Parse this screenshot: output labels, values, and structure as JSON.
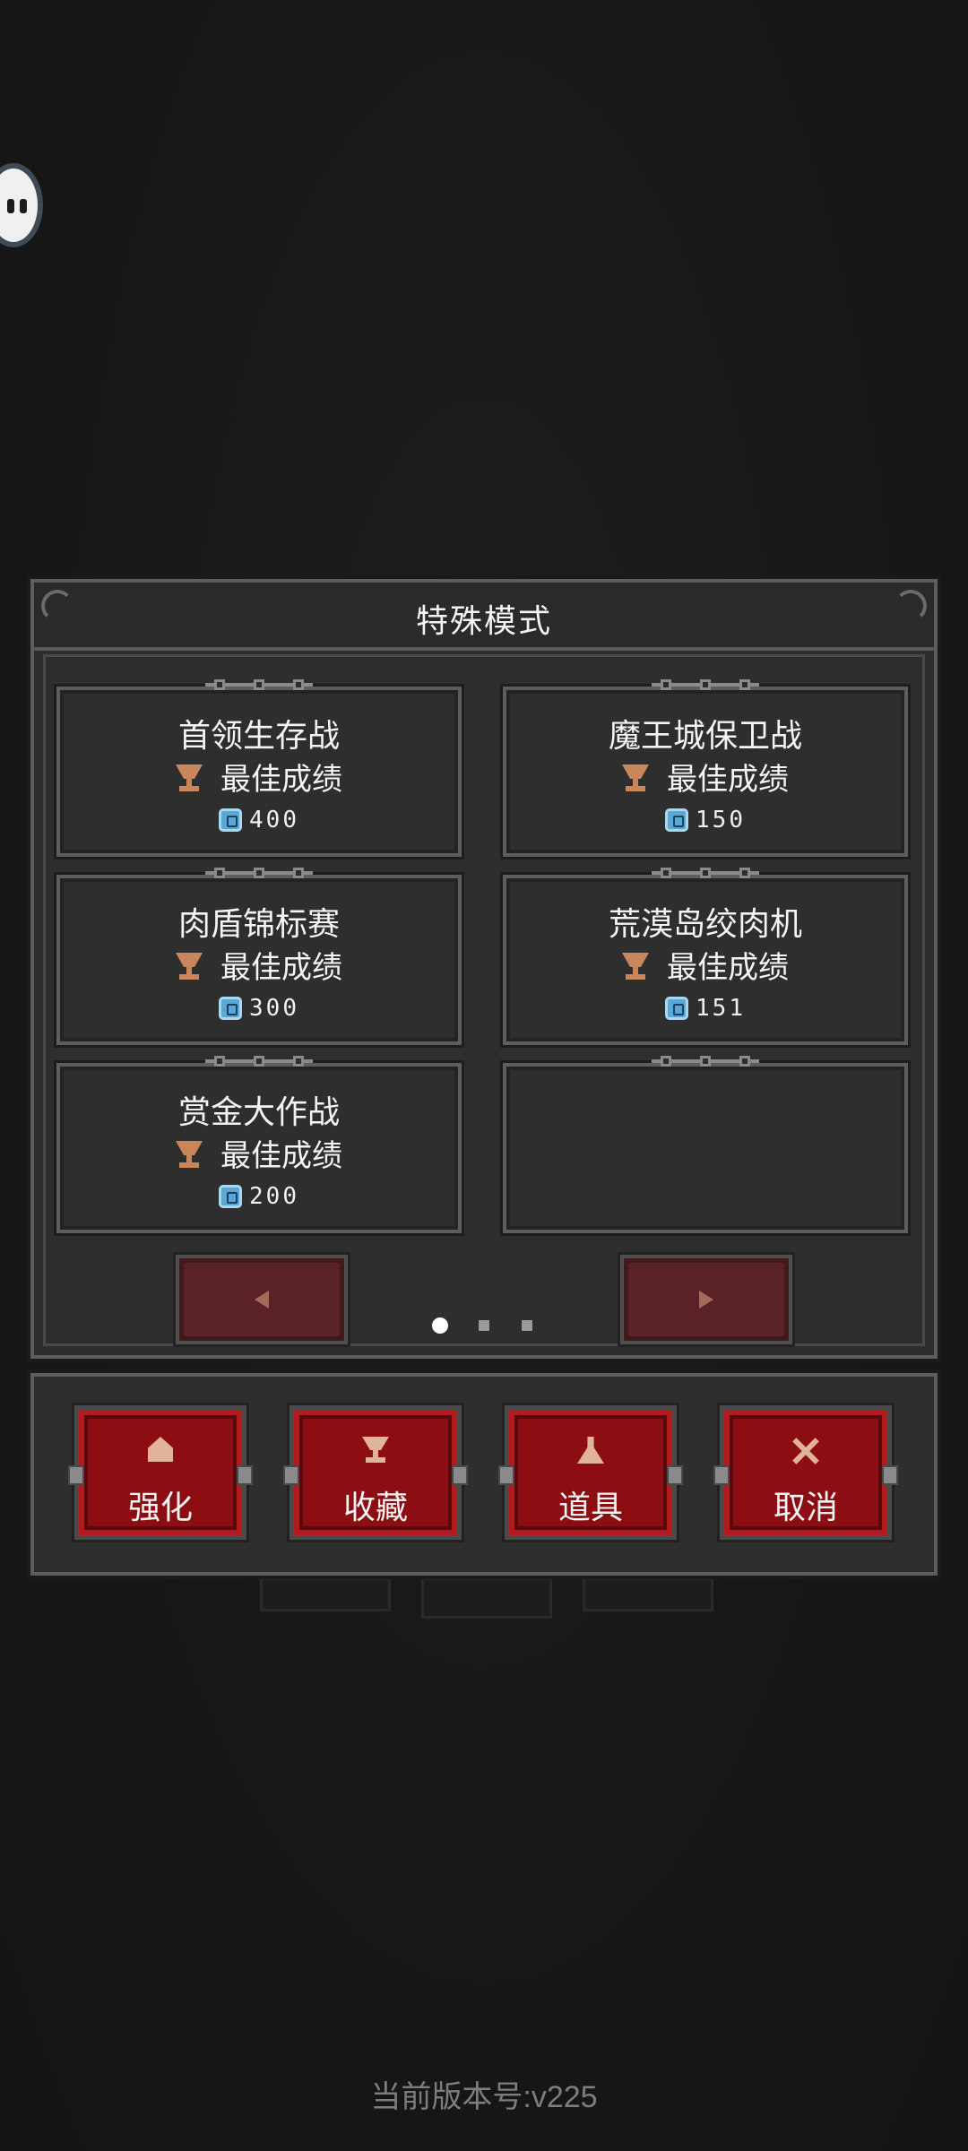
{
  "dialog": {
    "title": "特殊模式",
    "best_label": "最佳成绩",
    "modes": [
      {
        "name": "首领生存战",
        "score": "400"
      },
      {
        "name": "魔王城保卫战",
        "score": "150"
      },
      {
        "name": "肉盾锦标赛",
        "score": "300"
      },
      {
        "name": "荒漠岛绞肉机",
        "score": "151"
      },
      {
        "name": "赏金大作战",
        "score": "200"
      }
    ],
    "page_indicator": {
      "current": 1,
      "total": 3
    }
  },
  "actions": {
    "upgrade": "强化",
    "collection": "收藏",
    "items": "道具",
    "cancel": "取消"
  },
  "footer": {
    "version": "当前版本号:v225"
  },
  "colors": {
    "accent_red": "#8c0e12",
    "trophy": "#c8865a",
    "score_icon": "#5aa8d8"
  }
}
